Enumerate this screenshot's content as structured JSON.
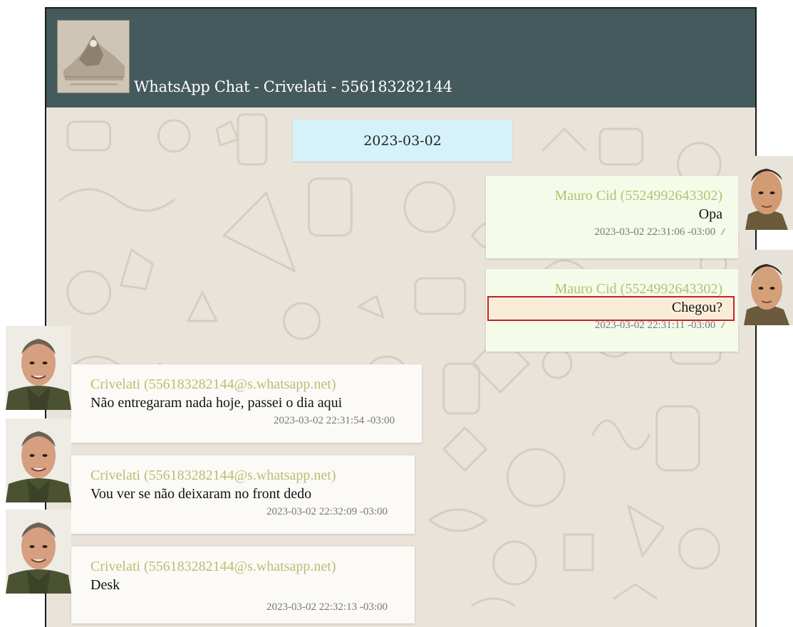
{
  "header": {
    "title": "WhatsApp Chat - Crivelati - 556183282144",
    "avatar_icon": "group-photo-avatar",
    "background_color": "#455a5c"
  },
  "date_separator": "2023-03-02",
  "messages": [
    {
      "direction": "outgoing",
      "sender": "Mauro Cid (5524992643302)",
      "text": "Opa",
      "timestamp": "2023-03-02 22:31:06 -03:00",
      "status_icon": "double-check-icon",
      "status_glyph": "//"
    },
    {
      "direction": "outgoing",
      "sender": "Mauro Cid (5524992643302)",
      "text": "Chegou?",
      "timestamp": "2023-03-02 22:31:11 -03:00",
      "status_icon": "double-check-icon",
      "status_glyph": "//",
      "highlighted": true
    },
    {
      "direction": "incoming",
      "sender": "Crivelati (556183282144@s.whatsapp.net)",
      "text": "Não entregaram nada hoje, passei o dia aqui",
      "timestamp": "2023-03-02 22:31:54 -03:00"
    },
    {
      "direction": "incoming",
      "sender": "Crivelati (556183282144@s.whatsapp.net)",
      "text": "Vou ver se não deixaram no front dedo",
      "timestamp": "2023-03-02 22:32:09 -03:00"
    },
    {
      "direction": "incoming",
      "sender": "Crivelati (556183282144@s.whatsapp.net)",
      "text": "Desk",
      "timestamp": "2023-03-02 22:32:13 -03:00"
    }
  ],
  "colors": {
    "sender_name": "#b7bf73",
    "outgoing_bubble": "#f5fbe9",
    "incoming_bubble": "#fbfaf6",
    "date_chip": "#d5f1fa",
    "highlight_border": "#c8202a"
  }
}
